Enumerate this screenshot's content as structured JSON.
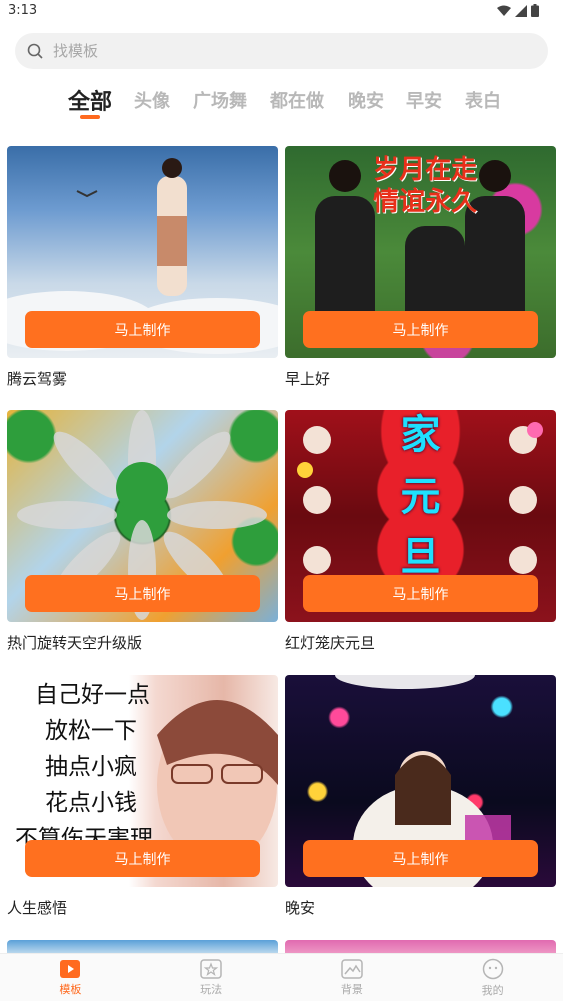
{
  "status": {
    "time": "3:13"
  },
  "search": {
    "placeholder": "找模板"
  },
  "tabs": [
    {
      "label": "全部",
      "active": true
    },
    {
      "label": "头像"
    },
    {
      "label": "广场舞"
    },
    {
      "label": "都在做"
    },
    {
      "label": "晚安"
    },
    {
      "label": "早安"
    },
    {
      "label": "表白"
    }
  ],
  "make_label": "马上制作",
  "cards": [
    {
      "title": "腾云驾雾"
    },
    {
      "title": "早上好",
      "overlay_line1": "岁月在走",
      "overlay_line2": "情谊永久"
    },
    {
      "title": "热门旋转天空升级版"
    },
    {
      "title": "红灯笼庆元旦",
      "chars": [
        "家",
        "元",
        "旦"
      ]
    },
    {
      "title": "人生感悟",
      "poem": [
        "自己好一点",
        "放松一下",
        "抽点小疯",
        "花点小钱",
        "不算伤天害理"
      ]
    },
    {
      "title": "晚安"
    }
  ],
  "bottom_nav": [
    {
      "label": "模板",
      "icon": "play-icon",
      "active": true
    },
    {
      "label": "玩法",
      "icon": "star-icon"
    },
    {
      "label": "背景",
      "icon": "image-icon"
    },
    {
      "label": "我的",
      "icon": "face-icon"
    }
  ],
  "colors": {
    "accent": "#ff6a1f",
    "button": "#ff701f"
  }
}
